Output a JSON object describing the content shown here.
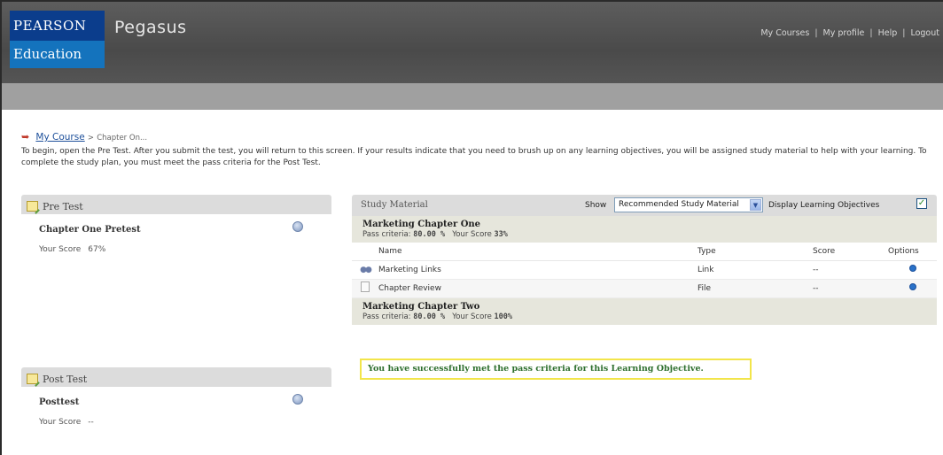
{
  "header": {
    "logo_top": "PEARSON",
    "logo_bottom": "Education",
    "app_name": "Pegasus",
    "nav": [
      "My Courses",
      "My profile",
      "Help",
      "Logout"
    ]
  },
  "breadcrumb": {
    "link": "My Course",
    "separator": ">",
    "current": "Chapter On..."
  },
  "intro": "To begin, open the Pre Test. After you submit the test, you will return to this screen. If your results indicate that you need to brush up on any learning objectives, you will be assigned study material to help with your learning. To complete the study plan, you must meet the pass criteria for the Post Test.",
  "pre_test": {
    "heading": "Pre Test",
    "title": "Chapter One Pretest",
    "score_label": "Your Score",
    "score_value": "67%"
  },
  "post_test": {
    "heading": "Post Test",
    "title": "Posttest",
    "score_label": "Your Score",
    "score_value": "--"
  },
  "study": {
    "heading": "Study Material",
    "show_label": "Show",
    "show_value": "Recommended Study Material",
    "display_lo_label": "Display Learning Objectives",
    "display_lo_checked": true,
    "columns": [
      "Name",
      "Type",
      "Score",
      "Options"
    ],
    "chapters": [
      {
        "name": "Marketing Chapter One",
        "pass_label": "Pass criteria:",
        "pass_value": "80.00 %",
        "score_label": "Your Score",
        "score_value": "33%",
        "rows": [
          {
            "icon": "link-icon",
            "name": "Marketing Links",
            "type": "Link",
            "score": "--"
          },
          {
            "icon": "file-icon",
            "name": "Chapter Review",
            "type": "File",
            "score": "--"
          }
        ]
      },
      {
        "name": "Marketing Chapter Two",
        "pass_label": "Pass criteria:",
        "pass_value": "80.00 %",
        "score_label": "Your Score",
        "score_value": "100%"
      }
    ],
    "success_message": "You have successfully met the pass criteria for this Learning Objective."
  },
  "colors": {
    "header_bg": "#4f4f4f",
    "subbar_bg": "#a0a0a0",
    "pearson_blue": "#0b3d8c",
    "education_blue": "#1473bd",
    "success_text": "#2e6f2e",
    "success_border": "#f2e54a"
  }
}
